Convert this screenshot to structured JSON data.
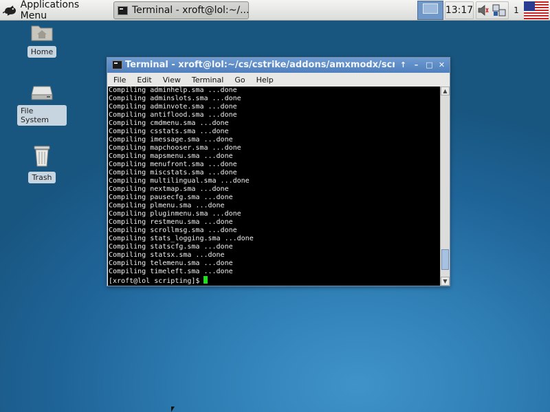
{
  "panel": {
    "app_menu_label": "Applications Menu",
    "task_button_label": "Terminal - xroft@lol:~/...",
    "clock": "13:17",
    "workspace_number": "1"
  },
  "desktop": {
    "icons": [
      {
        "label": "Home",
        "icon": "home-folder-icon"
      },
      {
        "label": "File System",
        "icon": "hard-drive-icon"
      },
      {
        "label": "Trash",
        "icon": "trash-icon"
      }
    ]
  },
  "terminal": {
    "title": "Terminal - xroft@lol:~/cs/cstrike/addons/amxmodx/scripting",
    "menu": [
      "File",
      "Edit",
      "View",
      "Terminal",
      "Go",
      "Help"
    ],
    "lines": [
      "Compiling adminhelp.sma ...done",
      "Compiling adminslots.sma ...done",
      "Compiling adminvote.sma ...done",
      "Compiling antiflood.sma ...done",
      "Compiling cmdmenu.sma ...done",
      "Compiling csstats.sma ...done",
      "Compiling imessage.sma ...done",
      "Compiling mapchooser.sma ...done",
      "Compiling mapsmenu.sma ...done",
      "Compiling menufront.sma ...done",
      "Compiling miscstats.sma ...done",
      "Compiling multilingual.sma ...done",
      "Compiling nextmap.sma ...done",
      "Compiling pausecfg.sma ...done",
      "Compiling plmenu.sma ...done",
      "Compiling pluginmenu.sma ...done",
      "Compiling restmenu.sma ...done",
      "Compiling scrollmsg.sma ...done",
      "Compiling stats_logging.sma ...done",
      "Compiling statscfg.sma ...done",
      "Compiling statsx.sma ...done",
      "Compiling telemenu.sma ...done",
      "Compiling timeleft.sma ...done"
    ],
    "prompt": "[xroft@lol scripting]$ ",
    "scroll_position": 0.96
  },
  "colors": {
    "desktop_bg": "#2a73aa",
    "titlebar": "#5b88c4",
    "terminal_bg": "#000000",
    "cursor": "#22dd22"
  }
}
